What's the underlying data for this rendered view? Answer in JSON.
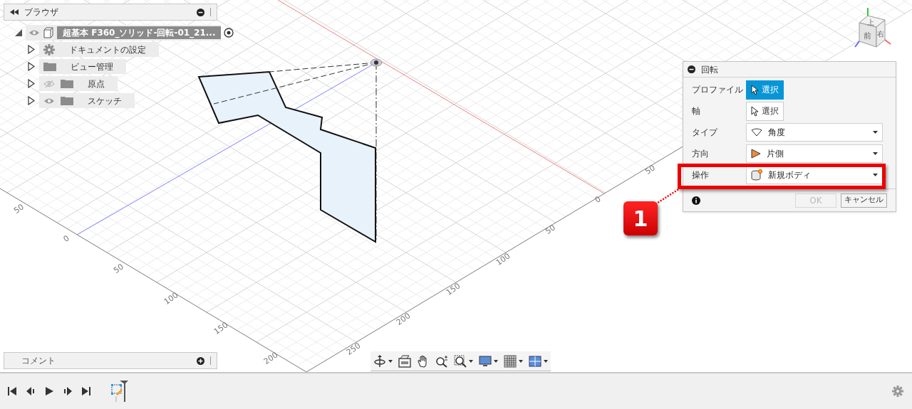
{
  "browser": {
    "title": "ブラウザ",
    "root": {
      "label": "超基本 F360_ソリッド-回転-01_21...",
      "expanded": true,
      "visible": true,
      "active": true,
      "children": [
        {
          "kind": "settings",
          "label": "ドキュメントの設定"
        },
        {
          "kind": "folder",
          "label": "ビュー管理"
        },
        {
          "kind": "folder",
          "label": "原点",
          "visible": false
        },
        {
          "kind": "folder",
          "label": "スケッチ",
          "visible": true
        }
      ]
    }
  },
  "comments": {
    "title": "コメント"
  },
  "view_cube": {
    "faces": [
      "上",
      "前",
      "右"
    ]
  },
  "grid_labels": {
    "left_edge": [
      "50",
      "0",
      "50",
      "100",
      "150",
      "200"
    ],
    "right_edge": [
      "250",
      "200",
      "150",
      "100",
      "50",
      "0",
      "50"
    ]
  },
  "dialog": {
    "title": "回転",
    "rows": [
      {
        "label": "プロファイル",
        "kind": "select",
        "value": "選択",
        "selected": true
      },
      {
        "label": "軸",
        "kind": "select",
        "value": "選択",
        "selected": false
      },
      {
        "label": "タイプ",
        "kind": "dropdown",
        "value": "角度"
      },
      {
        "label": "方向",
        "kind": "dropdown",
        "value": "片側"
      },
      {
        "label": "操作",
        "kind": "dropdown",
        "value": "新規ボディ",
        "highlighted": true
      }
    ],
    "ok": {
      "label": "OK",
      "disabled": true
    },
    "cancel": {
      "label": "キャンセル"
    }
  },
  "callout": {
    "number": "1"
  }
}
